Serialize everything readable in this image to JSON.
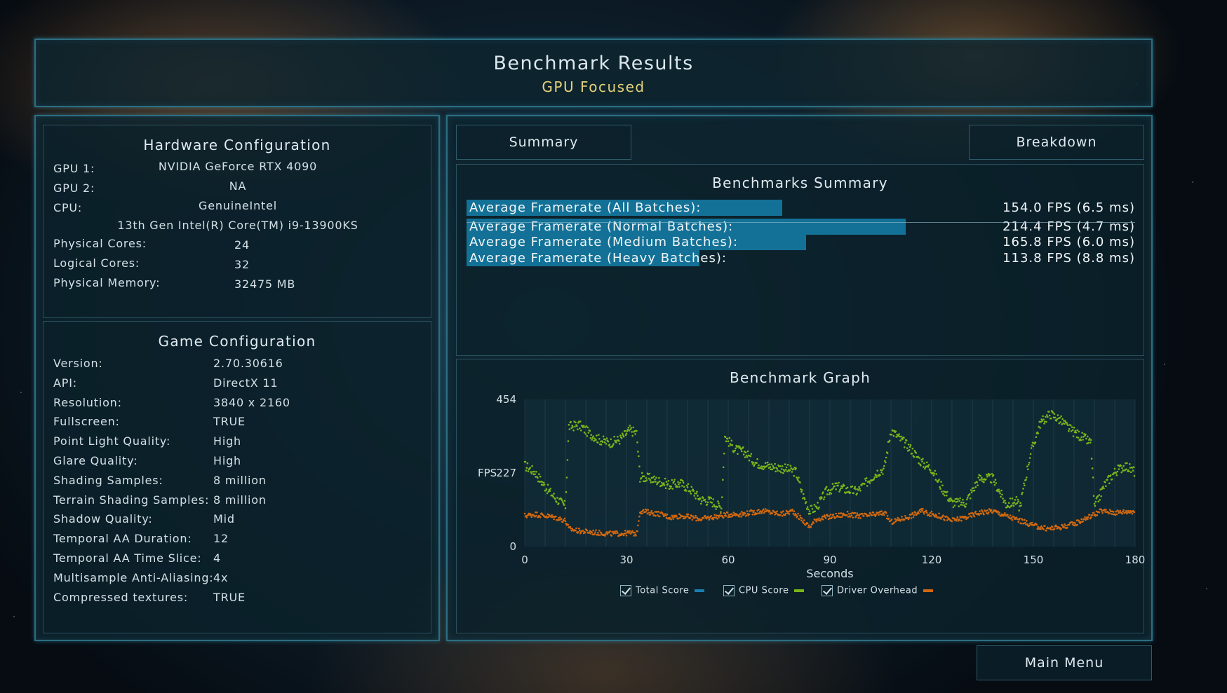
{
  "header": {
    "title": "Benchmark Results",
    "subtitle": "GPU Focused"
  },
  "hardware": {
    "title": "Hardware Configuration",
    "gpu1_label": "GPU 1:",
    "gpu1_value": "NVIDIA GeForce RTX 4090",
    "gpu2_label": "GPU 2:",
    "gpu2_value": "NA",
    "cpu_label": "CPU:",
    "cpu_value": "GenuineIntel",
    "cpu_model": "13th Gen Intel(R) Core(TM) i9-13900KS",
    "physical_cores_label": "Physical Cores:",
    "physical_cores_value": "24",
    "logical_cores_label": "Logical Cores:",
    "logical_cores_value": "32",
    "memory_label": "Physical Memory:",
    "memory_value": "32475  MB"
  },
  "game": {
    "title": "Game Configuration",
    "rows": [
      {
        "label": "Version:",
        "value": "2.70.30616"
      },
      {
        "label": "API:",
        "value": "DirectX 11"
      },
      {
        "label": "Resolution:",
        "value": "3840 x 2160"
      },
      {
        "label": "Fullscreen:",
        "value": "TRUE"
      },
      {
        "label": "Point Light Quality:",
        "value": "High"
      },
      {
        "label": "Glare Quality:",
        "value": "High"
      },
      {
        "label": "Shading Samples:",
        "value": "8 million"
      },
      {
        "label": "Terrain Shading Samples:",
        "value": "8 million"
      },
      {
        "label": "Shadow Quality:",
        "value": "Mid"
      },
      {
        "label": "Temporal AA Duration:",
        "value": "12"
      },
      {
        "label": "Temporal AA Time Slice:",
        "value": "4"
      },
      {
        "label": "Multisample Anti-Aliasing:",
        "value": "4x"
      },
      {
        "label": "Compressed textures:",
        "value": "TRUE"
      }
    ]
  },
  "tabs": {
    "summary": "Summary",
    "breakdown": "Breakdown"
  },
  "summary": {
    "title": "Benchmarks Summary",
    "rows": [
      {
        "label": "Average Framerate (All Batches):",
        "value": "154.0 FPS (6.5 ms)",
        "fps": 154.0
      },
      {
        "label": "Average Framerate (Normal Batches):",
        "value": "214.4 FPS (4.7 ms)",
        "fps": 214.4
      },
      {
        "label": "Average Framerate (Medium Batches):",
        "value": "165.8 FPS (6.0 ms)",
        "fps": 165.8
      },
      {
        "label": "Average Framerate (Heavy Batches):",
        "value": "113.8 FPS (8.8 ms)",
        "fps": 113.8
      }
    ],
    "bar_color": "#137197"
  },
  "graph": {
    "title": "Benchmark Graph",
    "legend": [
      {
        "label": "Total Score",
        "color": "#1a7fb0",
        "checked": true
      },
      {
        "label": "CPU Score",
        "color": "#79b51a",
        "checked": true
      },
      {
        "label": "Driver Overhead",
        "color": "#d2680f",
        "checked": true
      }
    ]
  },
  "chart_data": {
    "type": "scatter",
    "title": "Benchmark Graph",
    "xlabel": "Seconds",
    "ylabel": "FPS",
    "xlim": [
      0,
      180
    ],
    "ylim": [
      0,
      454
    ],
    "xticks": [
      0,
      30,
      60,
      90,
      120,
      150,
      180
    ],
    "yticks": [
      0,
      227,
      454
    ],
    "series": [
      {
        "name": "CPU Score",
        "color": "#79b51a",
        "x": [
          0,
          3,
          6,
          9,
          12,
          13,
          16,
          19,
          22,
          25,
          28,
          31,
          33,
          34,
          37,
          40,
          43,
          46,
          49,
          52,
          55,
          58,
          59,
          62,
          65,
          68,
          71,
          74,
          77,
          80,
          82,
          84,
          86,
          89,
          92,
          95,
          98,
          101,
          104,
          106,
          108,
          111,
          114,
          117,
          120,
          122,
          126,
          130,
          134,
          138,
          142,
          145,
          146,
          149,
          152,
          155,
          158,
          161,
          164,
          167,
          168,
          171,
          174,
          177,
          180
        ],
        "y": [
          250,
          230,
          185,
          150,
          125,
          370,
          375,
          350,
          330,
          320,
          330,
          360,
          350,
          215,
          210,
          200,
          190,
          195,
          175,
          145,
          140,
          120,
          340,
          300,
          290,
          260,
          250,
          245,
          240,
          230,
          160,
          110,
          120,
          170,
          185,
          175,
          170,
          200,
          230,
          240,
          360,
          330,
          300,
          260,
          240,
          200,
          135,
          135,
          210,
          210,
          130,
          140,
          120,
          280,
          380,
          410,
          390,
          360,
          340,
          320,
          120,
          190,
          230,
          250,
          230
        ]
      },
      {
        "name": "Driver Overhead",
        "color": "#d2680f",
        "x": [
          0,
          3,
          6,
          9,
          12,
          13,
          16,
          19,
          22,
          25,
          28,
          31,
          33,
          34,
          37,
          40,
          43,
          46,
          49,
          52,
          55,
          58,
          61,
          64,
          67,
          70,
          73,
          76,
          79,
          82,
          84,
          86,
          89,
          92,
          95,
          98,
          101,
          104,
          106,
          108,
          111,
          114,
          117,
          120,
          122,
          126,
          130,
          134,
          138,
          142,
          146,
          150,
          154,
          158,
          162,
          166,
          170,
          174,
          180
        ],
        "y": [
          95,
          100,
          95,
          90,
          80,
          55,
          48,
          45,
          42,
          40,
          40,
          42,
          40,
          110,
          105,
          100,
          90,
          95,
          90,
          85,
          90,
          95,
          100,
          100,
          105,
          110,
          105,
          100,
          110,
          80,
          60,
          85,
          90,
          95,
          100,
          95,
          95,
          100,
          105,
          75,
          85,
          95,
          110,
          100,
          95,
          80,
          90,
          105,
          110,
          95,
          80,
          65,
          55,
          60,
          70,
          90,
          110,
          105,
          110
        ]
      }
    ]
  },
  "main_menu": "Main Menu"
}
